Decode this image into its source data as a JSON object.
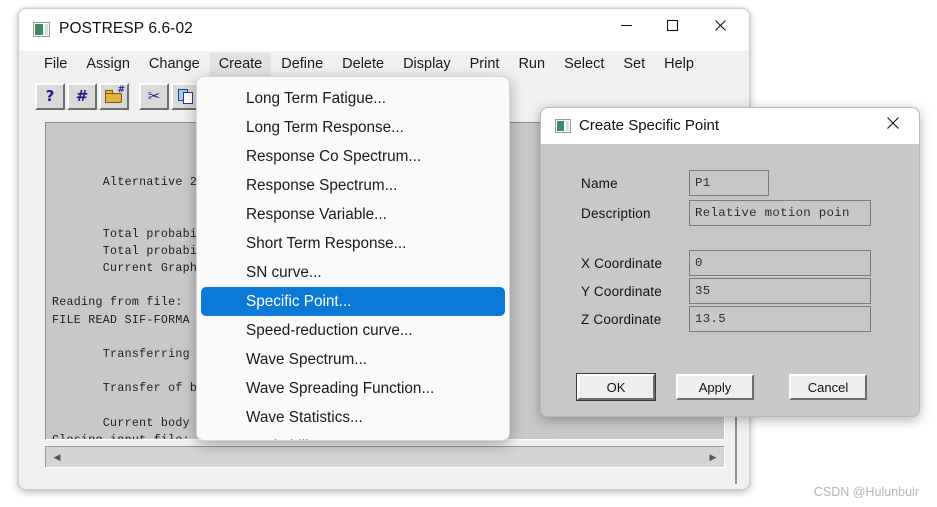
{
  "window": {
    "title": "POSTRESP  6.6-02",
    "icon": "app-icon",
    "controls": {
      "minimize": "—",
      "maximize": "☐",
      "close": "✕"
    }
  },
  "menubar": {
    "items": [
      {
        "label": "File",
        "active": false
      },
      {
        "label": "Assign",
        "active": false
      },
      {
        "label": "Change",
        "active": false
      },
      {
        "label": "Create",
        "active": true
      },
      {
        "label": "Define",
        "active": false
      },
      {
        "label": "Delete",
        "active": false
      },
      {
        "label": "Display",
        "active": false
      },
      {
        "label": "Print",
        "active": false
      },
      {
        "label": "Run",
        "active": false
      },
      {
        "label": "Select",
        "active": false
      },
      {
        "label": "Set",
        "active": false
      },
      {
        "label": "Help",
        "active": false
      }
    ]
  },
  "toolbar": {
    "buttons": [
      {
        "icon": "help-question-icon",
        "glyph": "?"
      },
      {
        "icon": "hash-number-icon",
        "glyph": "#"
      },
      {
        "icon": "open-folder-icon",
        "glyph": ""
      },
      {
        "icon": "cut-scissors-icon",
        "glyph": "✂"
      },
      {
        "icon": "copy-icon",
        "glyph": ""
      },
      {
        "icon": "paste-icon",
        "glyph": ""
      }
    ]
  },
  "console": {
    "text": "\n\n       Alternative 2\n\n\n       Total probabi                      00\n       Total probabi                      00\n       Current Graph\n\nReading from file:\nFILE READ SIF-FORMA\n\n       Transferring\n\n       Transfer of b\n\n       Current body\nClosing input file:",
    "scrollbar": {
      "left_arrow": "◀",
      "right_arrow": "▶"
    }
  },
  "create_menu": {
    "items": [
      {
        "label": "Long Term Fatigue...",
        "selected": false
      },
      {
        "label": "Long Term Response...",
        "selected": false
      },
      {
        "label": "Response Co Spectrum...",
        "selected": false
      },
      {
        "label": "Response Spectrum...",
        "selected": false
      },
      {
        "label": "Response Variable...",
        "selected": false
      },
      {
        "label": "Short Term Response...",
        "selected": false
      },
      {
        "label": "SN curve...",
        "selected": false
      },
      {
        "label": "Specific Point...",
        "selected": true
      },
      {
        "label": "Speed-reduction curve...",
        "selected": false
      },
      {
        "label": "Wave Spectrum...",
        "selected": false
      },
      {
        "label": "Wave Spreading Function...",
        "selected": false
      },
      {
        "label": "Wave Statistics...",
        "selected": false
      },
      {
        "label": "Workability...",
        "selected": false
      }
    ],
    "highlight_color": "#0b7ad6"
  },
  "dialog": {
    "title": "Create Specific Point",
    "close_glyph": "✕",
    "fields": [
      {
        "label": "Name",
        "value": "P1"
      },
      {
        "label": "Description",
        "value": "Relative motion poin"
      },
      {
        "label": "X Coordinate",
        "value": "0"
      },
      {
        "label": "Y Coordinate",
        "value": "35"
      },
      {
        "label": "Z Coordinate",
        "value": "13.5"
      }
    ],
    "buttons": [
      {
        "label": "OK"
      },
      {
        "label": "Apply"
      },
      {
        "label": "Cancel"
      }
    ]
  },
  "watermark": "CSDN @Hulunbuir"
}
